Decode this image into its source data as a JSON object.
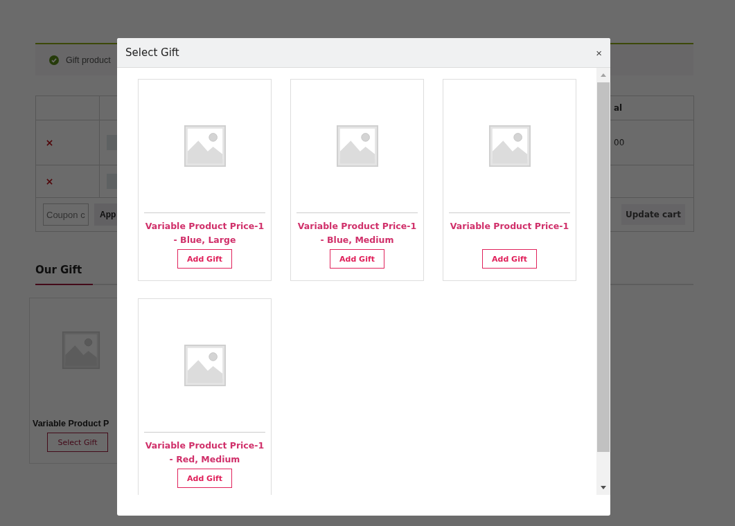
{
  "notice": {
    "text": "Gift product"
  },
  "cart": {
    "header": {
      "column_last": "al"
    },
    "rows": [
      {
        "cell_last": "00"
      },
      {
        "cell_last": ""
      }
    ],
    "coupon": {
      "placeholder": "Coupon c"
    },
    "apply_button": "App",
    "update_button": "Update cart"
  },
  "gift_tabs": [
    {
      "label": "Our Gift",
      "selected": true
    }
  ],
  "gift_cards": [
    {
      "title": "Variable Product P",
      "button": "Select Gift"
    }
  ],
  "modal": {
    "title": "Select Gift",
    "close": "×",
    "products": [
      {
        "title": "Variable Product Price-1 - Blue, Large",
        "button": "Add Gift"
      },
      {
        "title": "Variable Product Price-1 - Blue, Medium",
        "button": "Add Gift"
      },
      {
        "title": "Variable Product Price-1",
        "button": "Add Gift"
      },
      {
        "title": "Variable Product Price-1 - Red, Medium",
        "button": "Add Gift"
      }
    ]
  }
}
